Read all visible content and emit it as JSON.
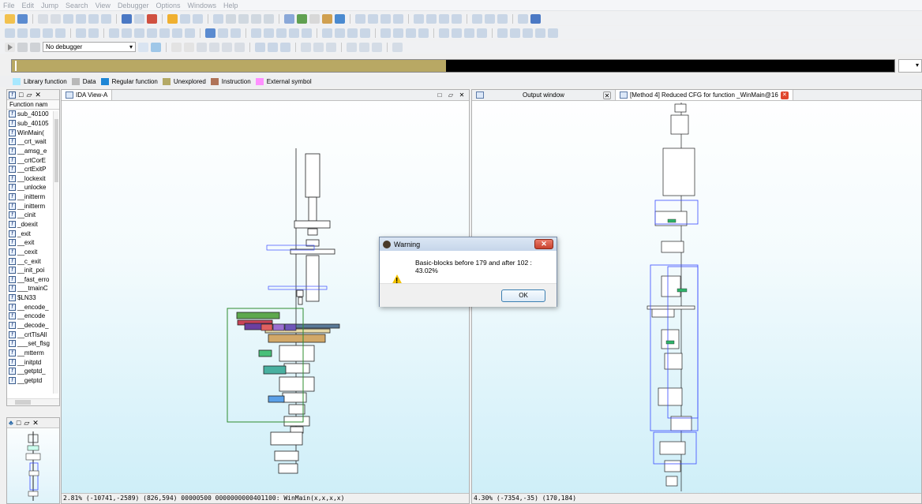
{
  "menu": [
    "File",
    "Edit",
    "Jump",
    "Search",
    "View",
    "Debugger",
    "Options",
    "Windows",
    "Help"
  ],
  "debugger_select": "No debugger",
  "legend": [
    {
      "label": "Library function",
      "color": "#a8e8ff"
    },
    {
      "label": "Data",
      "color": "#b8b8b8"
    },
    {
      "label": "Regular function",
      "color": "#1e86d6"
    },
    {
      "label": "Unexplored",
      "color": "#b4a966"
    },
    {
      "label": "Instruction",
      "color": "#b07358"
    },
    {
      "label": "External symbol",
      "color": "#ff90ff"
    }
  ],
  "functions_panel": {
    "column_header": "Function nam",
    "items": [
      "sub_40100",
      "sub_40105",
      "WinMain(",
      "__crt_wait",
      "__amsg_e",
      "__crtCorE",
      "__crtExitP",
      "__lockexit",
      "__unlocke",
      "__initterm",
      "__initterm",
      "__cinit",
      "_doexit",
      "_exit",
      "__exit",
      "__cexit",
      "__c_exit",
      "__init_poi",
      "__fast_erro",
      "___tmainC",
      "$LN33",
      "__encode_",
      "__encode",
      "__decode_",
      "__crtTlsAll",
      "___set_flsg",
      "__mtterm",
      "__initptd",
      "__getptd_",
      "__getptd"
    ]
  },
  "ida_view": {
    "tab_label": "IDA View-A",
    "status": "2.81% (-10741,-2589) (826,594) 00000500 0000000000401100: WinMain(x,x,x,x)"
  },
  "right_view": {
    "tabs": [
      "Output window",
      "[Method 4] Reduced CFG for function _WinMain@16"
    ],
    "status": "4.30% (-7354,-35) (170,184)"
  },
  "dialog": {
    "title": "Warning",
    "message": "Basic-blocks before 179 and after 102 : 43.02%",
    "ok_label": "OK"
  }
}
